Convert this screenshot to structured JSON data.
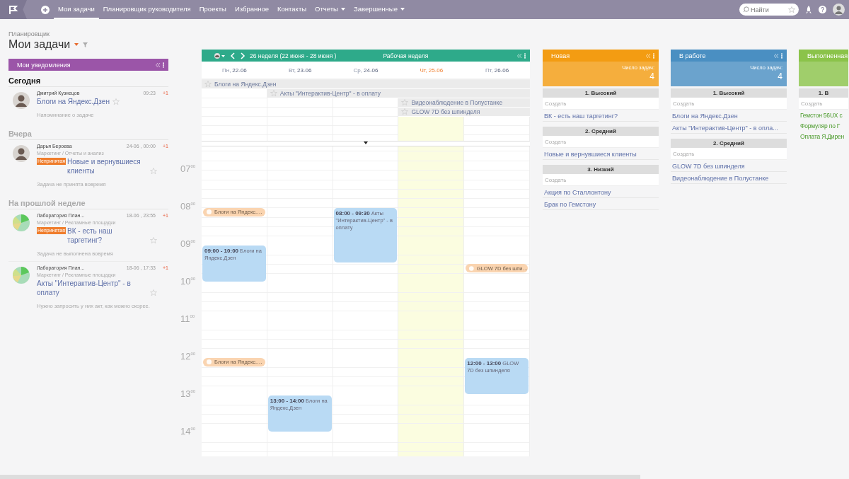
{
  "nav": {
    "tabs": [
      {
        "label": "Мои задачи",
        "selected": true,
        "menu": false
      },
      {
        "label": "Планировщик руководителя",
        "selected": false,
        "menu": false
      },
      {
        "label": "Проекты",
        "selected": false,
        "menu": false
      },
      {
        "label": "Избранное",
        "selected": false,
        "menu": false
      },
      {
        "label": "Контакты",
        "selected": false,
        "menu": false
      },
      {
        "label": "Отчеты",
        "selected": false,
        "menu": true
      },
      {
        "label": "Завершенные",
        "selected": false,
        "menu": true
      }
    ],
    "search": {
      "placeholder": "Найти"
    }
  },
  "breadcrumb": "Планировщик",
  "title": "Мои задачи",
  "notifications": {
    "title": "Мои уведомления",
    "sections": [
      {
        "title": "Сегодня",
        "current": true,
        "items": [
          {
            "kind": "person",
            "author": "Дмитрий Кузнецов",
            "time": "09:23",
            "counter": "+1",
            "task": "Блоги на Яндекс.Дзен",
            "note": "Напоминание о задаче"
          }
        ]
      },
      {
        "title": "Вчера",
        "current": false,
        "items": [
          {
            "kind": "person",
            "author": "Дарья Бероева",
            "time": "24-06 , 00:00",
            "counter": "+1",
            "path": "Маркетинг / Отчеты и анализ",
            "badge": "Непринятая",
            "task": "Новые и вернувшиеся клиенты",
            "note": "Задача не принята вовремя"
          }
        ]
      },
      {
        "title": "На прошлой неделе",
        "current": false,
        "items": [
          {
            "kind": "group",
            "author": "Лаборатория План...",
            "time": "18-06 , 23:55",
            "counter": "+1",
            "path": "Маркетинг / Рекламные площадки",
            "badge": "Непринятая",
            "task": "ВК - есть наш таргетинг?",
            "note": "Задача не выполнена вовремя"
          },
          {
            "kind": "group",
            "author": "Лаборатория План...",
            "time": "18-06 , 17:33",
            "counter": "+1",
            "path": "Маркетинг / Рекламные площадки",
            "task": "Акты \"Интерактив-Центр\" - в оплату",
            "note": "Нужно запросить у них акт, как можно скорее."
          }
        ]
      }
    ]
  },
  "calendar": {
    "week": "26 неделя  (22 июня - 28 июня )",
    "mode": "Рабочая неделя",
    "days": [
      {
        "weekday": "Пн,",
        "date": "22-06",
        "today": false,
        "events": [
          {
            "kind": "reminder",
            "text": "Блоги на Яндекс.…"
          },
          {
            "kind": "timed",
            "text": "**09:00 - 10:00** Блоги на Яндекс.Дзен"
          },
          {
            "kind": "reminder",
            "text": "Блоги на Яндекс.…"
          }
        ]
      },
      {
        "weekday": "Вт,",
        "date": "23-06",
        "today": false,
        "events": [
          {
            "kind": "timed",
            "text": "**13:00 - 14:00** Блоги на Яндекс.Дзен"
          }
        ]
      },
      {
        "weekday": "Ср,",
        "date": "24-06",
        "today": false,
        "events": [
          {
            "kind": "timed",
            "text": "**08:00 - 09:30** Акты \"Интерактив-Центр\" - в оплату"
          }
        ]
      },
      {
        "weekday": "Чт,",
        "date": "25-06",
        "today": true
      },
      {
        "weekday": "Пт,",
        "date": "26-06",
        "today": false,
        "events": [
          {
            "kind": "reminder",
            "text": "GLOW 7D без шпи…"
          },
          {
            "kind": "timed",
            "text": "**12:00 - 13:00** GLOW 7D без шпинделя"
          }
        ]
      }
    ],
    "all_day": [
      "Блоги на Яндекс.Дзен",
      "Акты \"Интерактив-Центр\" - в оплату",
      "Видеонаблюдение в Полустанке",
      "GLOW 7D без шпинделя"
    ],
    "hours": [
      "07$^{00}$",
      "08$^{00}$",
      "09$^{00}$",
      "10$^{00}$",
      "11$^{00}$",
      "12$^{00}$",
      "13$^{00}$",
      "14$^{00}$"
    ]
  },
  "board": [
    {
      "title": "Новая",
      "color": "#f39c12",
      "kind": "open",
      "count_label": "Число задач:",
      "count": "4",
      "groups": [
        {
          "label": "1. Высокий",
          "placeholder": "Создать",
          "tasks": [
            "ВК - есть наш таргетинг?"
          ]
        },
        {
          "label": "2. Средний",
          "placeholder": "Создать",
          "tasks": [
            "Новые и вернувшиеся клиенты"
          ]
        },
        {
          "label": "3. Низкий",
          "placeholder": "Создать",
          "tasks": [
            "Акция по Сталлонтону",
            "Брак по Гемстону"
          ]
        }
      ]
    },
    {
      "title": "В работе",
      "color": "#4a8fc2",
      "kind": "open",
      "count_label": "Число задач:",
      "count": "4",
      "groups": [
        {
          "label": "1. Высокий",
          "placeholder": "Создать",
          "tasks": [
            "Блоги на Яндекс.Дзен",
            "Акты \"Интерактив-Центр\" - в опла..."
          ]
        },
        {
          "label": "2. Средний",
          "placeholder": "Создать",
          "tasks": [
            "GLOW 7D без шпинделя",
            "Видеонаблюдение в Полустанке"
          ]
        }
      ]
    },
    {
      "title": "Выполненная",
      "color": "#8bc34a",
      "kind": "done",
      "groups": [
        {
          "label": "1. В",
          "placeholder": "Создать",
          "tasks": [
            "Гемстон 56UX с",
            "Формуляр по Г",
            "Оплата Я.Дирен"
          ]
        }
      ]
    }
  ]
}
